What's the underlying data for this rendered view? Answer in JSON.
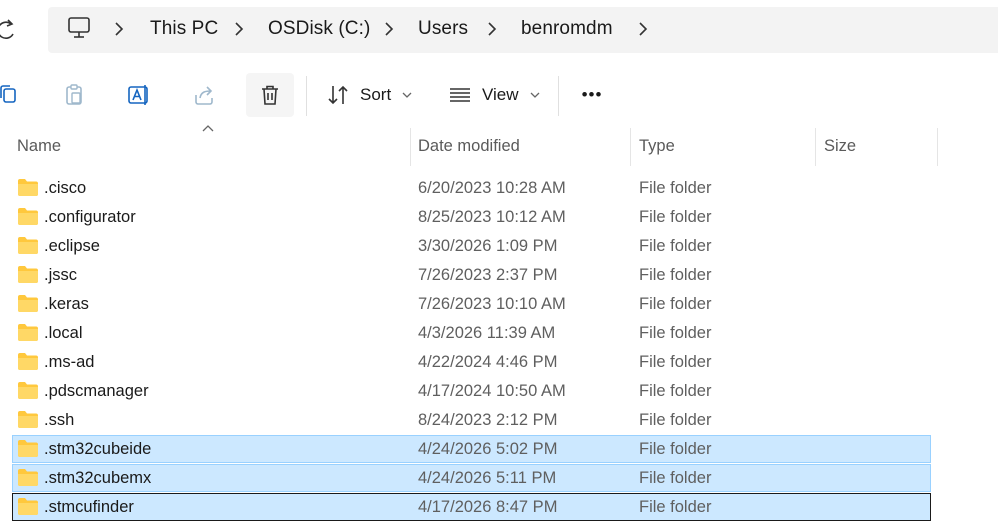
{
  "address_bar": {
    "crumbs": [
      "This PC",
      "OSDisk (C:)",
      "Users",
      "benromdm"
    ]
  },
  "command_bar": {
    "sort_label": "Sort",
    "view_label": "View",
    "more_label": "•••"
  },
  "columns": {
    "name": "Name",
    "date": "Date modified",
    "type": "Type",
    "size": "Size",
    "sorted_by": "Name",
    "sort_direction": "ascending"
  },
  "rows": [
    {
      "name": ".cisco",
      "date": "6/20/2023 10:28 AM",
      "type": "File folder",
      "size": "",
      "selected": false
    },
    {
      "name": ".configurator",
      "date": "8/25/2023 10:12 AM",
      "type": "File folder",
      "size": "",
      "selected": false
    },
    {
      "name": ".eclipse",
      "date": "3/30/2026 1:09 PM",
      "type": "File folder",
      "size": "",
      "selected": false
    },
    {
      "name": ".jssc",
      "date": "7/26/2023 2:37 PM",
      "type": "File folder",
      "size": "",
      "selected": false
    },
    {
      "name": ".keras",
      "date": "7/26/2023 10:10 AM",
      "type": "File folder",
      "size": "",
      "selected": false
    },
    {
      "name": ".local",
      "date": "4/3/2026 11:39 AM",
      "type": "File folder",
      "size": "",
      "selected": false
    },
    {
      "name": ".ms-ad",
      "date": "4/22/2024 4:46 PM",
      "type": "File folder",
      "size": "",
      "selected": false
    },
    {
      "name": ".pdscmanager",
      "date": "4/17/2024 10:50 AM",
      "type": "File folder",
      "size": "",
      "selected": false
    },
    {
      "name": ".ssh",
      "date": "8/24/2023 2:12 PM",
      "type": "File folder",
      "size": "",
      "selected": false
    },
    {
      "name": ".stm32cubeide",
      "date": "4/24/2026 5:02 PM",
      "type": "File folder",
      "size": "",
      "selected": true
    },
    {
      "name": ".stm32cubemx",
      "date": "4/24/2026 5:11 PM",
      "type": "File folder",
      "size": "",
      "selected": true
    },
    {
      "name": ".stmcufinder",
      "date": "4/17/2026 8:47 PM",
      "type": "File folder",
      "size": "",
      "selected": true,
      "focused": true
    }
  ],
  "colors": {
    "selection_fill": "#cce8ff",
    "selection_border": "#99d1ff",
    "folder_yellow": "#ffc83d",
    "address_bg": "#f3f3f3"
  }
}
